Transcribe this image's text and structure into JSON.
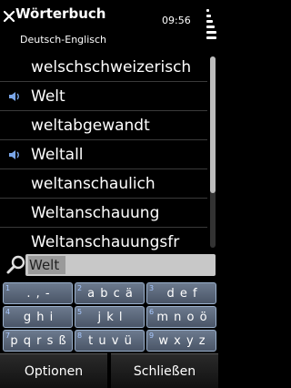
{
  "header": {
    "title": "Wörterbuch",
    "subtitle": "Deutsch-Englisch",
    "clock": "09:56"
  },
  "list": {
    "items": [
      {
        "word": "welschschweizerisch",
        "audio": false
      },
      {
        "word": "Welt",
        "audio": true
      },
      {
        "word": "weltabgewandt",
        "audio": false
      },
      {
        "word": "Weltall",
        "audio": true
      },
      {
        "word": "weltanschaulich",
        "audio": false
      },
      {
        "word": "Weltanschauung",
        "audio": false
      },
      {
        "word": "Weltanschauungsfr",
        "audio": false
      }
    ]
  },
  "search": {
    "value": "Welt"
  },
  "keypad": {
    "keys": [
      {
        "num": "1",
        "label": ". , -"
      },
      {
        "num": "2",
        "label": "a b c ä"
      },
      {
        "num": "3",
        "label": "d e f"
      },
      {
        "num": "4",
        "label": "g h i"
      },
      {
        "num": "5",
        "label": "j k l"
      },
      {
        "num": "6",
        "label": "m n o ö"
      },
      {
        "num": "7",
        "label": "p q r s ß"
      },
      {
        "num": "8",
        "label": "t u v ü"
      },
      {
        "num": "9",
        "label": "w x y z"
      }
    ]
  },
  "softkeys": {
    "left": "Optionen",
    "right": "Schließen"
  },
  "icons": {
    "close": "close-icon",
    "audio": "speaker-icon",
    "search": "magnifier-icon",
    "signal": "signal-icon"
  }
}
